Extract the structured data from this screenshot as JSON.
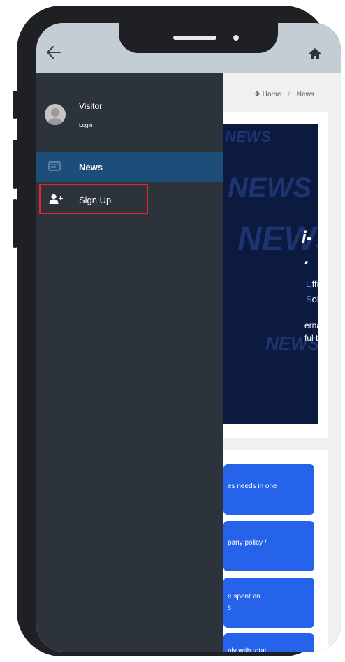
{
  "header": {
    "back_icon": "arrow-left-icon",
    "home_icon": "home-icon"
  },
  "breadcrumb": {
    "home": "Home",
    "separator": "/",
    "current": "News"
  },
  "drawer": {
    "user": {
      "name": "Visitor",
      "login_label": "Login"
    },
    "items": [
      {
        "label": "News",
        "icon": "newspaper-icon",
        "active": true
      },
      {
        "label": "Sign Up",
        "icon": "user-plus-icon",
        "highlighted": true
      }
    ]
  },
  "banner": {
    "watermark": "NEWS",
    "headline_part1": "i-",
    "headline_part2": ".",
    "efficient_first": "E",
    "efficient_rest": "fficient",
    "solution_first": "S",
    "solution_rest": "olution",
    "line1": "ernal",
    "line2": "ful tools."
  },
  "features": [
    {
      "text": "es needs in one"
    },
    {
      "text": "pany policy /"
    },
    {
      "text": "e spent on",
      "text2": "s"
    },
    {
      "text": "nly with total"
    }
  ],
  "colors": {
    "drawer_bg": "#2d333b",
    "active_item_bg": "#1c4e79",
    "highlight_border": "#e5262b",
    "feature_bg": "#2563eb",
    "banner_bg": "#0b1a3e",
    "accent_blue": "#3f82ff"
  }
}
